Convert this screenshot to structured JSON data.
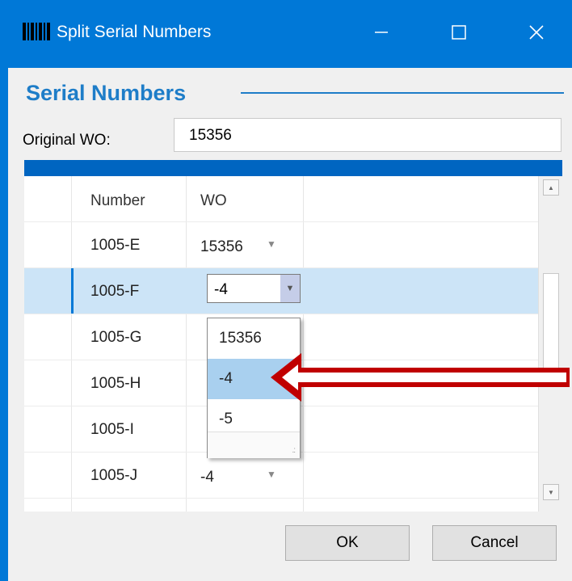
{
  "window": {
    "title": "Split Serial Numbers",
    "title_icon": "barcode-icon"
  },
  "group": {
    "header": "Serial Numbers"
  },
  "original_wo": {
    "label": "Original WO:",
    "value": "15356"
  },
  "grid": {
    "headers": {
      "number": "Number",
      "wo": "WO"
    },
    "rows": [
      {
        "number": "1005-E",
        "wo": "15356"
      },
      {
        "number": "1005-F",
        "wo": "-4"
      },
      {
        "number": "1005-G",
        "wo": ""
      },
      {
        "number": "1005-H",
        "wo": ""
      },
      {
        "number": "1005-I",
        "wo": ""
      },
      {
        "number": "1005-J",
        "wo": "-4"
      }
    ],
    "selected_row": 1
  },
  "dropdown": {
    "current": "-4",
    "options": [
      "15356",
      "-4",
      "-5"
    ],
    "highlighted": "-4"
  },
  "buttons": {
    "ok": "OK",
    "cancel": "Cancel"
  },
  "colors": {
    "titlebar": "#0078d7",
    "accent": "#1e7dc8",
    "selected_row": "#cce4f7",
    "dropdown_highlight": "#a9d0ef",
    "annotation_arrow": "#c00000"
  }
}
